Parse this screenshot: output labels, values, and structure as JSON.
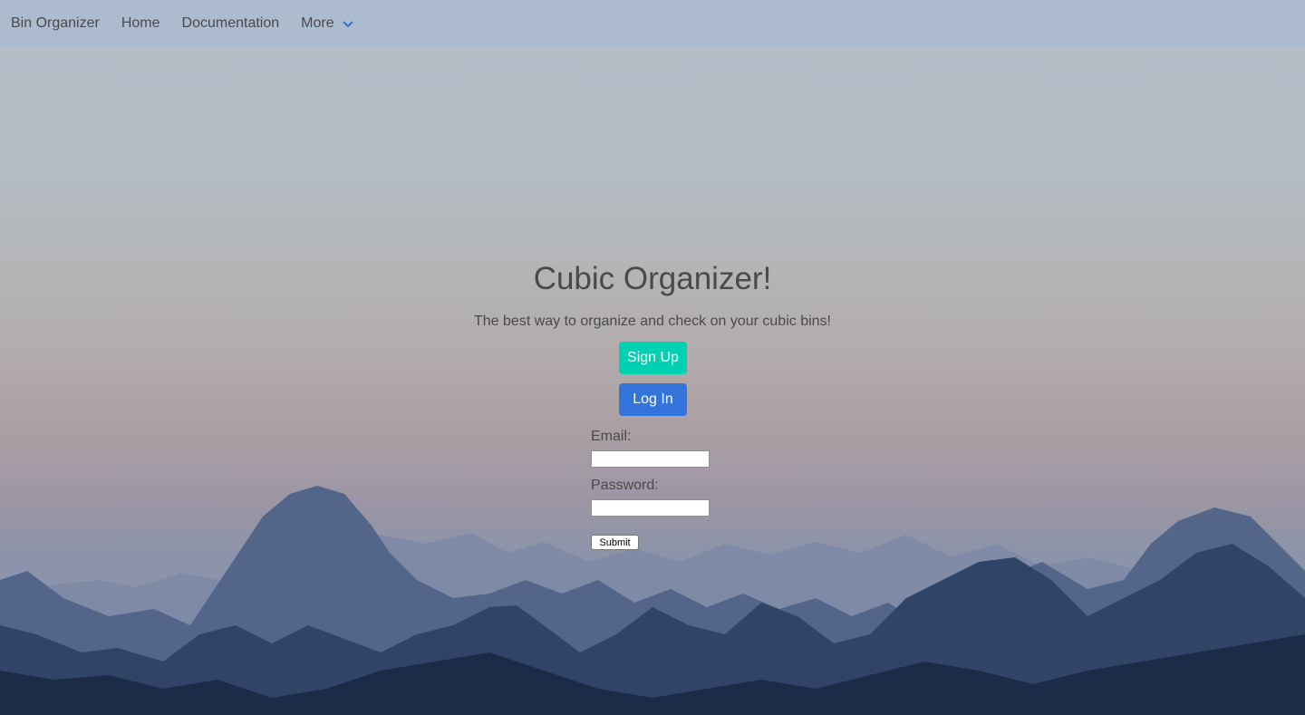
{
  "nav": {
    "brand": "Bin Organizer",
    "home": "Home",
    "documentation": "Documentation",
    "more": "More"
  },
  "hero": {
    "title": "Cubic Organizer!",
    "subtitle": "The best way to organize and check on your cubic bins!",
    "signup_label": "Sign Up",
    "login_label": "Log In"
  },
  "form": {
    "email_label": "Email:",
    "email_value": "",
    "password_label": "Password:",
    "password_value": "",
    "submit_label": "Submit"
  },
  "colors": {
    "signup": "#00d1b2",
    "login": "#3273dc",
    "nav_chevron": "#3273dc",
    "text": "#4a4a4a"
  },
  "icons": {
    "more_dropdown": "chevron-down-icon"
  },
  "background": "mountain-landscape-at-dusk"
}
